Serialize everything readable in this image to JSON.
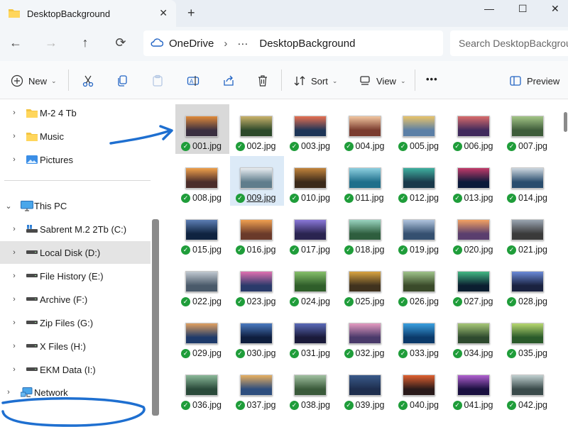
{
  "window": {
    "tab_title": "DesktopBackground",
    "tab_close": "✕",
    "new_tab": "+",
    "minimize": "—",
    "maximize": "☐",
    "close": "✕"
  },
  "address_bar": {
    "segments": [
      "OneDrive",
      "DesktopBackground"
    ],
    "overflow": "···",
    "separator": "›",
    "search_placeholder": "Search DesktopBackground"
  },
  "command_bar": {
    "new_label": "New",
    "sort_label": "Sort",
    "view_label": "View",
    "more_label": "•••",
    "preview_label": "Preview"
  },
  "sidebar": {
    "items": [
      {
        "label": "M-2 4 Tb",
        "icon": "folder-icon"
      },
      {
        "label": "Music",
        "icon": "folder-icon"
      },
      {
        "label": "Pictures",
        "icon": "pictures-icon"
      },
      {
        "label": "This PC",
        "icon": "computer-icon"
      },
      {
        "label": "Sabrent M.2 2Tb (C:)",
        "icon": "system-drive-icon"
      },
      {
        "label": "Local Disk (D:)",
        "icon": "drive-icon",
        "selected": true
      },
      {
        "label": "File History (E:)",
        "icon": "drive-icon"
      },
      {
        "label": "Archive (F:)",
        "icon": "drive-icon"
      },
      {
        "label": "Zip Files (G:)",
        "icon": "drive-icon"
      },
      {
        "label": "X Files (H:)",
        "icon": "drive-icon"
      },
      {
        "label": "EKM Data (I:)",
        "icon": "drive-icon"
      },
      {
        "label": "Network",
        "icon": "network-icon"
      }
    ]
  },
  "files": [
    "001.jpg",
    "002.jpg",
    "003.jpg",
    "004.jpg",
    "005.jpg",
    "006.jpg",
    "007.jpg",
    "008.jpg",
    "009.jpg",
    "010.jpg",
    "011.jpg",
    "012.jpg",
    "013.jpg",
    "014.jpg",
    "015.jpg",
    "016.jpg",
    "017.jpg",
    "018.jpg",
    "019.jpg",
    "020.jpg",
    "021.jpg",
    "022.jpg",
    "023.jpg",
    "024.jpg",
    "025.jpg",
    "026.jpg",
    "027.jpg",
    "028.jpg",
    "029.jpg",
    "030.jpg",
    "031.jpg",
    "032.jpg",
    "033.jpg",
    "034.jpg",
    "035.jpg",
    "036.jpg",
    "037.jpg",
    "038.jpg",
    "039.jpg",
    "040.jpg",
    "041.jpg",
    "042.jpg"
  ],
  "selected_file": "001.jpg",
  "hovered_file": "009.jpg",
  "colors": {
    "sync_check": "#1f9d3a",
    "annotation": "#1e6fd0",
    "selection": "#d9d9d9",
    "hover": "#dceaf7"
  }
}
